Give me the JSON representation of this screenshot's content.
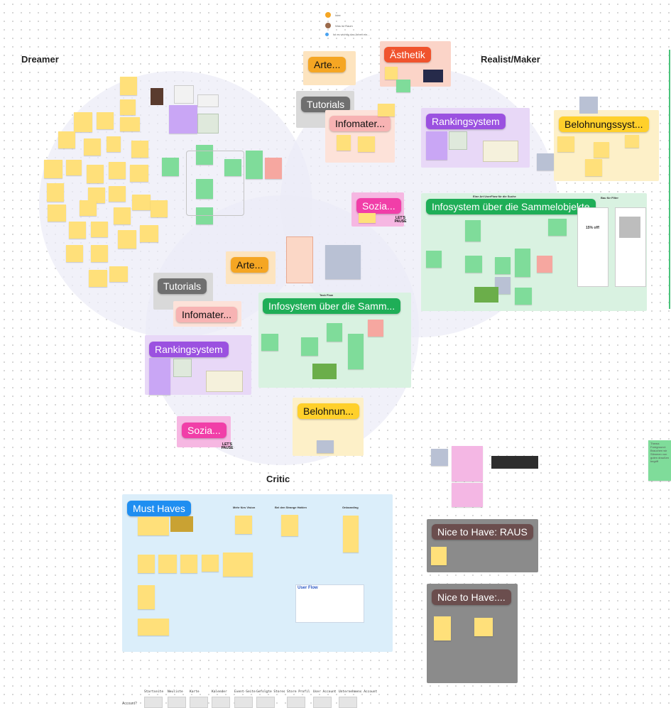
{
  "legend": {
    "items": [
      "Idee",
      "Was ist Raum",
      "Ist es wichtig das Arbeit ein..."
    ]
  },
  "zones": {
    "dreamer": "Dreamer",
    "realist": "Realist/Maker",
    "critic": "Critic"
  },
  "tags": {
    "arte_top": "Arte...",
    "aesthetik": "Ästhetik",
    "tutorials_top": "Tutorials",
    "infomater_top": "Infomater...",
    "ranking_top": "Rankingsystem",
    "belohnung_top": "Belohnungssyst...",
    "sozia_top": "Sozia...",
    "infosystem_top": "Infosystem über die Sammelobjekte",
    "arte_mid": "Arte...",
    "tutorials_mid": "Tutorials",
    "infomater_mid": "Infomater...",
    "infosystem_mid": "Infosystem über die Samm...",
    "ranking_mid": "Rankingsystem",
    "belohnung_mid": "Belohnun...",
    "sozia_mid": "Sozia...",
    "must_haves": "Must Haves",
    "nice_raus": "Nice to Have: RAUS",
    "nice_2": "Nice to Have:..."
  },
  "critic_headers": [
    "Mehr fürs Vision",
    "Bei den Strange Hahlen",
    "Onboarding"
  ],
  "realist_labels": {
    "flow": "Eine Art UserFlow für die Suche",
    "filter": "Bau für Filter",
    "offer": "15% off!"
  },
  "task_flow": "Task Flow",
  "user_flow": "User Flow",
  "side_note": "Thema Foreground: Brauchen wir Stimmen von guten draußen begriff",
  "stickers": {
    "lets_pause": "LET'S PAUSE"
  },
  "account_bar": {
    "label": "Account?",
    "columns": [
      "Startseite",
      "Neuliste",
      "Karte",
      "Kalender",
      "Event-Seite",
      "Gefolgte Stores",
      "Store Profil",
      "User Account",
      "Unternehmens Account"
    ]
  },
  "colors": {
    "tag_orange": "#f5a623",
    "tag_red": "#f0532d",
    "tag_gray": "#6f6f6f",
    "tag_pink": "#f7b3b3",
    "tag_purple": "#9b51e0",
    "tag_yellow": "#ffd02b",
    "tag_magenta": "#f13ea8",
    "tag_green": "#1fae57",
    "tag_blue": "#1f8ef1",
    "tag_brown": "#6b4e4e"
  }
}
